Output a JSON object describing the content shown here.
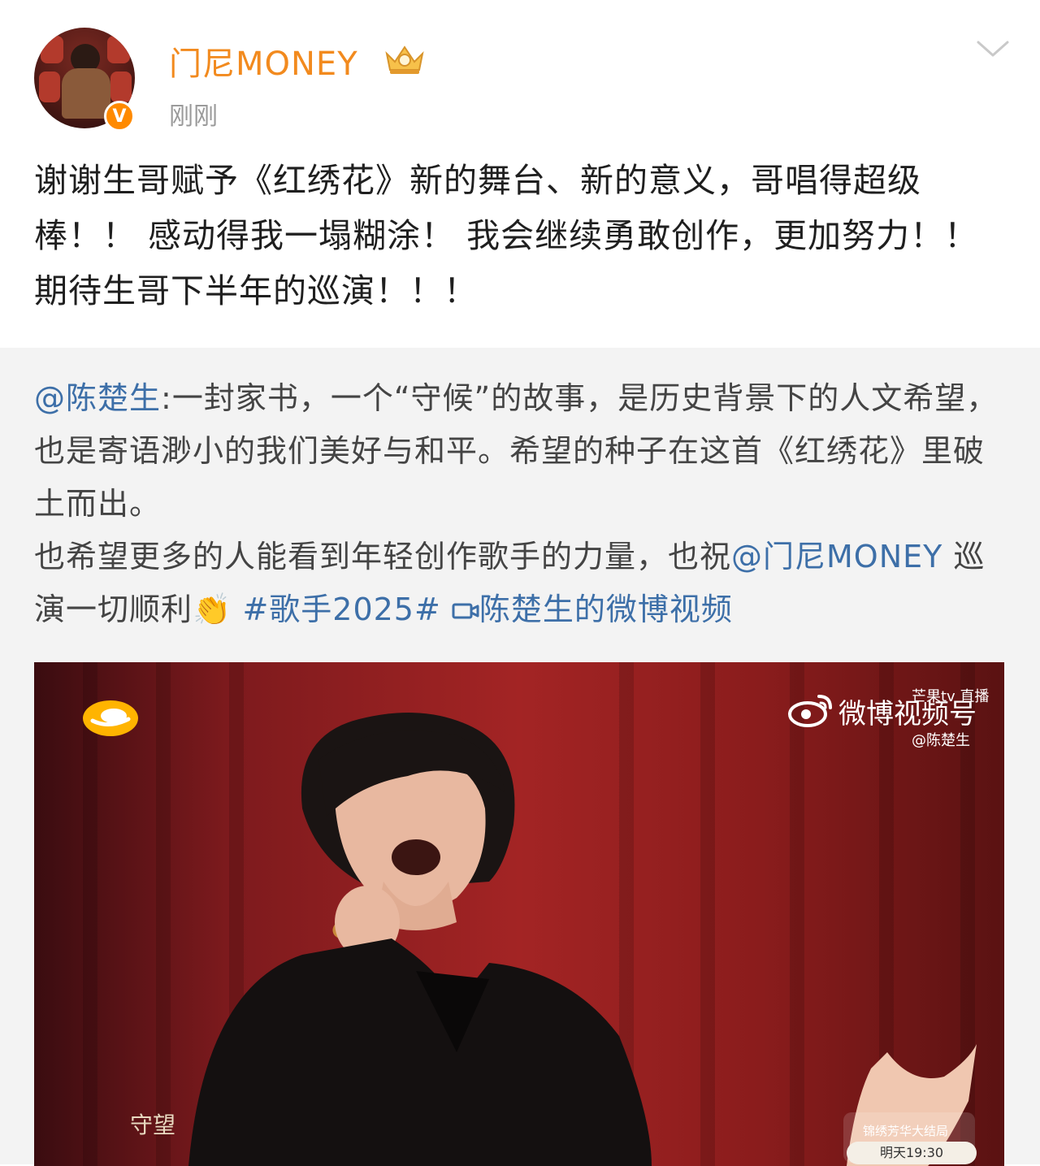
{
  "post": {
    "username": "门尼MONEY",
    "time": "刚刚",
    "avatar_badge": "V",
    "text": "谢谢生哥赋予《红绣花》新的舞台、新的意义，哥唱得超级棒！！ 感动得我一塌糊涂！ 我会继续勇敢创作，更加努力！！ 期待生哥下半年的巡演！！！"
  },
  "repost": {
    "mention": "@陈楚生",
    "text1": ":一封家书，一个“守候”的故事，是历史背景下的人文希望，也是寄语渺小的我们美好与和平。希望的种子在这首《红绣花》里破土而出。",
    "text2": "也希望更多的人能看到年轻创作歌手的力量，也祝",
    "mention2": "@门尼MONEY",
    "text3": " 巡演一切顺利",
    "emoji": "👏",
    "hashtag": "#歌手2025#",
    "video_link": "陈楚生的微博视频"
  },
  "video": {
    "watermark_main": "微博视频号",
    "watermark_top": "芒果tv 直播",
    "watermark_handle": "@陈楚生",
    "live_title": "锦绣芳华大结局",
    "live_time": "明天19:30",
    "side_text": "守望"
  },
  "colors": {
    "username": "#f28a1e",
    "link": "#3d6fa8",
    "verified": "#ff8a00"
  },
  "icons": [
    "verified-badge-icon",
    "crown-icon",
    "chevron-down-icon",
    "video-link-icon",
    "weibo-logo-icon",
    "mango-tv-logo-icon"
  ]
}
